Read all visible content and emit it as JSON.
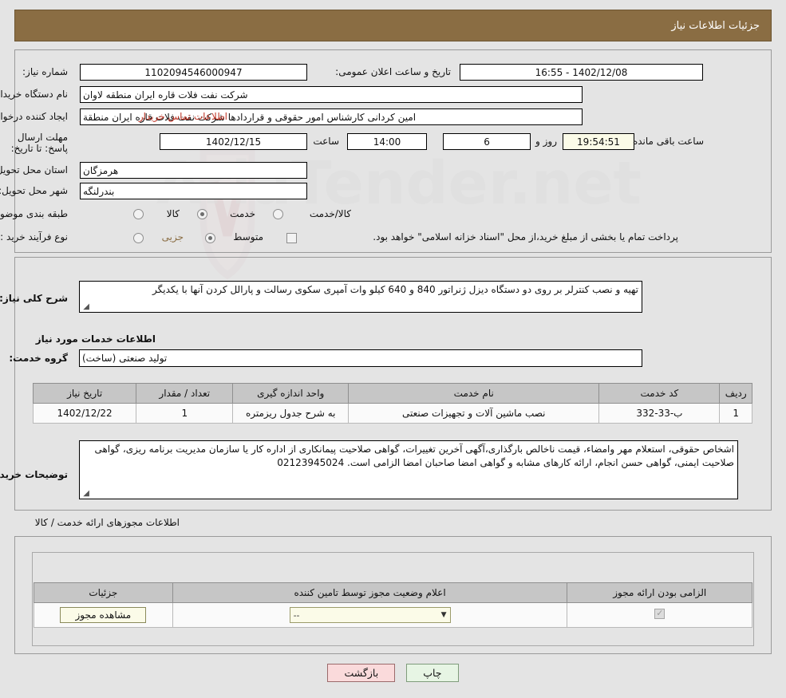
{
  "header": {
    "title": "جزئیات اطلاعات نیاز"
  },
  "form": {
    "need_number_label": "شماره نیاز:",
    "need_number_value": "1102094546000947",
    "announce_label": "تاریخ و ساعت اعلان عمومی:",
    "announce_value": "1402/12/08 - 16:55",
    "buyer_org_label": "نام دستگاه خریدار:",
    "buyer_org_value": "شرکت نفت فلات قاره ایران منطقه لاوان",
    "creator_label": "ایجاد کننده درخواست:",
    "creator_value": "امین کردانی کارشناس امور حقوقی و قراردادها شرکت نفت فلات قاره ایران منطقة",
    "contact_link": "اطلاعات تماس خریدار",
    "deadline_label": "مهلت ارسال پاسخ: تا تاریخ:",
    "deadline_date": "1402/12/15",
    "hour_label": "ساعت",
    "deadline_time": "14:00",
    "days_value": "6",
    "days_label": "روز و",
    "remaining_time": "19:54:51",
    "remaining_label": "ساعت باقی مانده",
    "province_label": "استان محل تحویل:",
    "province_value": "هرمزگان",
    "city_label": "شهر محل تحویل:",
    "city_value": "بندرلنگه",
    "category_label": "طبقه بندی موضوعی:",
    "category_options": [
      "کالا",
      "خدمت",
      "کالا/خدمت"
    ],
    "category_selected_index": 1,
    "process_label": "نوع فرآیند خرید :",
    "process_options": [
      "جزیی",
      "متوسط"
    ],
    "process_selected_index": 1,
    "treasury_checkbox_text": "پرداخت تمام یا بخشی از مبلغ خرید،از محل \"اسناد خزانه اسلامی\" خواهد بود.",
    "treasury_checked": false
  },
  "description": {
    "label": "شرح کلی نیاز:",
    "value": "تهیه و نصب کنترلر بر روی دو دستگاه دیزل ژنراتور 840 و 640 کیلو وات آمپری سکوی رسالت و پارالل کردن آنها با یکدیگر"
  },
  "services_section": {
    "caption": "اطلاعات خدمات مورد نیاز",
    "group_label": "گروه خدمت:",
    "group_value": "تولید صنعتی (ساخت)"
  },
  "services_table": {
    "headers": [
      "ردیف",
      "کد خدمت",
      "نام خدمت",
      "واحد اندازه گیری",
      "تعداد / مقدار",
      "تاریخ نیاز"
    ],
    "rows": [
      {
        "row": "1",
        "code": "ب-33-332",
        "name": "نصب ماشین آلات و تجهیزات صنعتی",
        "unit": "به شرح جدول ریزمتره",
        "quantity": "1",
        "date": "1402/12/22"
      }
    ]
  },
  "buyer_notes": {
    "label": "توضیحات خریدار:",
    "value": "اشخاص حقوقی، استعلام مهر وامضاء، قیمت ناخالص بارگذاری،آگهی آخرین تغییرات، گواهی صلاحیت پیمانکاری از اداره کار یا سازمان مدیریت  برنامه ریزی، گواهی صلاحیت ایمنی، گواهی حسن انجام، ارائه کارهای مشابه و گواهی امضا صاحبان امضا الزامی است. 02123945024"
  },
  "licenses_section": {
    "caption": "اطلاعات مجوزهای ارائه خدمت / کالا",
    "headers": [
      "الزامی بودن ارائه مجوز",
      "اعلام وضعیت مجوز توسط تامین کننده",
      "جزئیات"
    ],
    "rows": [
      {
        "required_checked": true,
        "status_value": "--",
        "detail_button": "مشاهده مجوز"
      }
    ]
  },
  "footer": {
    "back_button": "بازگشت",
    "print_button": "چاپ"
  },
  "colors": {
    "header_bar": "#8a6d43",
    "link": "#c0392b",
    "back_button": "#fadadb",
    "print_button": "#e7f5e4",
    "field_cream": "#fbfbe8"
  }
}
